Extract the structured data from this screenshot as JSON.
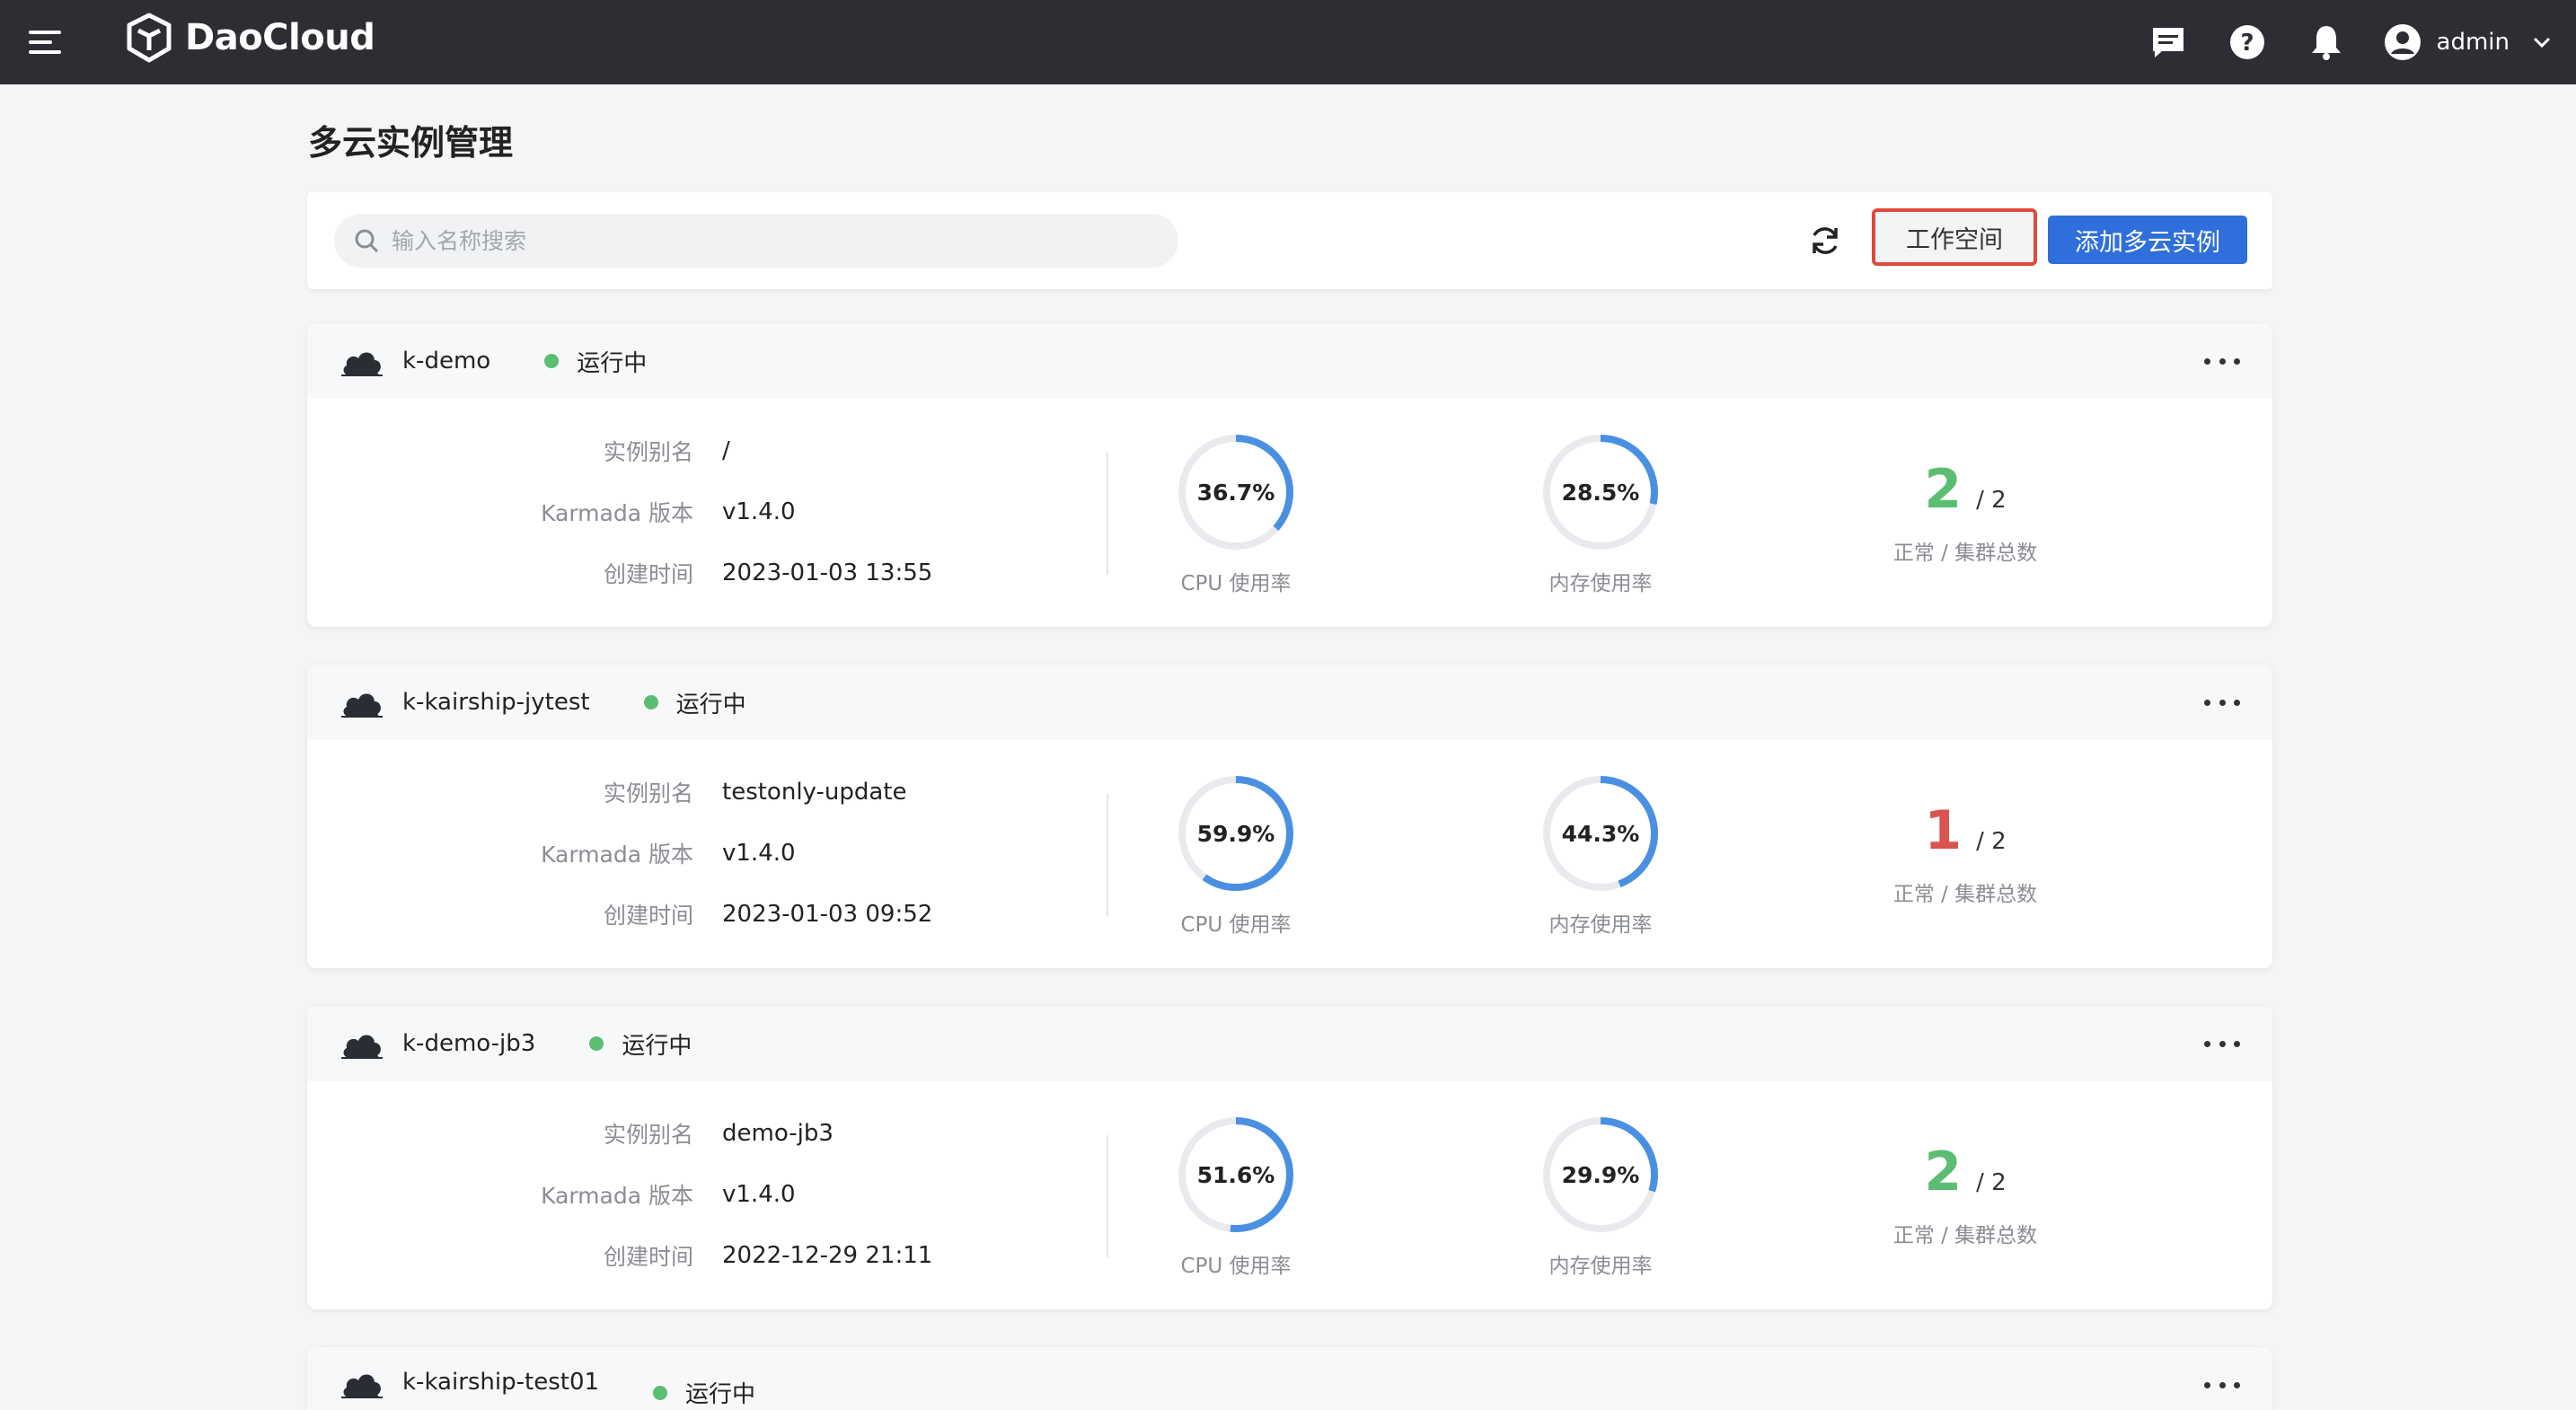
{
  "header": {
    "brand": "DaoCloud",
    "user": "admin",
    "icons": [
      "menu-icon",
      "chat-icon",
      "help-icon",
      "bell-icon",
      "user-avatar-icon",
      "chevron-down-icon"
    ]
  },
  "page": {
    "title": "多云实例管理"
  },
  "toolbar": {
    "search_placeholder": "输入名称搜索",
    "workspace_label": "工作空间",
    "add_label": "添加多云实例"
  },
  "colors": {
    "accent": "#2f6fdb",
    "ring": "#4a90e2",
    "ok": "#5bbd72",
    "bad": "#d9534f",
    "highlight": "#e04a3a"
  },
  "labels": {
    "alias": "实例别名",
    "karmada": "Karmada 版本",
    "created": "创建时间",
    "cpu": "CPU 使用率",
    "mem": "内存使用率",
    "clusters": "正常 / 集群总数"
  },
  "instances": [
    {
      "name": "k-demo",
      "status": "运行中",
      "alias": "/",
      "version": "v1.4.0",
      "created": "2023-01-03 13:55",
      "cpu": "36.7%",
      "cpu_pct": 36.7,
      "mem": "28.5%",
      "mem_pct": 28.5,
      "ok": "2",
      "total": "/ 2",
      "ok_state": "good"
    },
    {
      "name": "k-kairship-jytest",
      "status": "运行中",
      "alias": "testonly-update",
      "version": "v1.4.0",
      "created": "2023-01-03 09:52",
      "cpu": "59.9%",
      "cpu_pct": 59.9,
      "mem": "44.3%",
      "mem_pct": 44.3,
      "ok": "1",
      "total": "/ 2",
      "ok_state": "bad"
    },
    {
      "name": "k-demo-jb3",
      "status": "运行中",
      "alias": "demo-jb3",
      "version": "v1.4.0",
      "created": "2022-12-29 21:11",
      "cpu": "51.6%",
      "cpu_pct": 51.6,
      "mem": "29.9%",
      "mem_pct": 29.9,
      "ok": "2",
      "total": "/ 2",
      "ok_state": "good"
    },
    {
      "name": "k-kairship-test01",
      "status": "运行中"
    }
  ]
}
